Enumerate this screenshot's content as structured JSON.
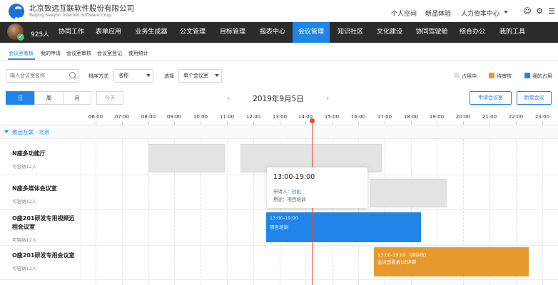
{
  "brand": {
    "name_cn": "北京致远互联软件股份有限公司",
    "name_en": "BeiJing Seeyon Internet Software Corp."
  },
  "top_links": {
    "personal_space": "个人空间",
    "new_product": "新品体验",
    "hr_center": "人力资本中心"
  },
  "icons": {
    "top_icon_1": "☺",
    "top_icon_2": "⚙",
    "top_icon_3": "☰"
  },
  "user": {
    "count": "925人"
  },
  "nav": {
    "items": [
      {
        "label": "协同工作"
      },
      {
        "label": "表单应用"
      },
      {
        "label": "业务生成器"
      },
      {
        "label": "公文管理"
      },
      {
        "label": "目标管理"
      },
      {
        "label": "报表中心"
      },
      {
        "label": "会议管理"
      },
      {
        "label": "知识社区"
      },
      {
        "label": "文化建设"
      },
      {
        "label": "协同驾驶舱"
      },
      {
        "label": "综合办公"
      },
      {
        "label": "我的工具"
      }
    ],
    "active_index": 6
  },
  "subtabs": [
    {
      "label": "会议室看板"
    },
    {
      "label": "我的申请"
    },
    {
      "label": "会议室审核"
    },
    {
      "label": "会议室登记"
    },
    {
      "label": "使用统计"
    }
  ],
  "filters": {
    "search_placeholder": "输入会议室名称",
    "sort_label": "排序方式",
    "sort_value": "名称",
    "select_label": "选择",
    "select_value": "单个会议室"
  },
  "legend": [
    {
      "label": "占用中",
      "color": "#e3e3e3"
    },
    {
      "label": "待审核",
      "color": "#e6992f"
    },
    {
      "label": "我的占用",
      "color": "#1f86e8"
    }
  ],
  "view": {
    "day": "日",
    "week": "周",
    "month": "月",
    "today": "今天",
    "date": "2019年9月5日",
    "prev": "‹",
    "next": "›",
    "apply_btn": "申请会议室",
    "new_meeting_btn": "新建会议"
  },
  "hours": [
    "06:00",
    "07:00",
    "08:00",
    "09:00",
    "10:00",
    "11:00",
    "12:00",
    "13:00",
    "14:00",
    "15:00",
    "16:00",
    "17:00",
    "18:00",
    "19:00",
    "20:00",
    "21:00",
    "22:00",
    "23:00"
  ],
  "group": {
    "label": "致远互联 - 北京"
  },
  "rooms": [
    {
      "name": "N座多功能厅",
      "capacity": "可容纳12人"
    },
    {
      "name": "N座多媒体会议室",
      "capacity": "可容纳12人"
    },
    {
      "name": "O座201研发专用视频远程会议室",
      "capacity": "可容纳12人"
    },
    {
      "name": "O座201研发专用会议室",
      "capacity": "可容纳12人"
    }
  ],
  "bookings": {
    "mine": {
      "time": "13:00-19:00",
      "title": "项目培训"
    },
    "pending": {
      "time": "13:00-19:00（待审核）",
      "title": "会议室看板UE评审"
    }
  },
  "popup": {
    "time": "13:00-19:00",
    "applicant_label": "申请人：",
    "applicant": "封彪",
    "purpose_label": "用途：",
    "purpose": "项目培训"
  }
}
